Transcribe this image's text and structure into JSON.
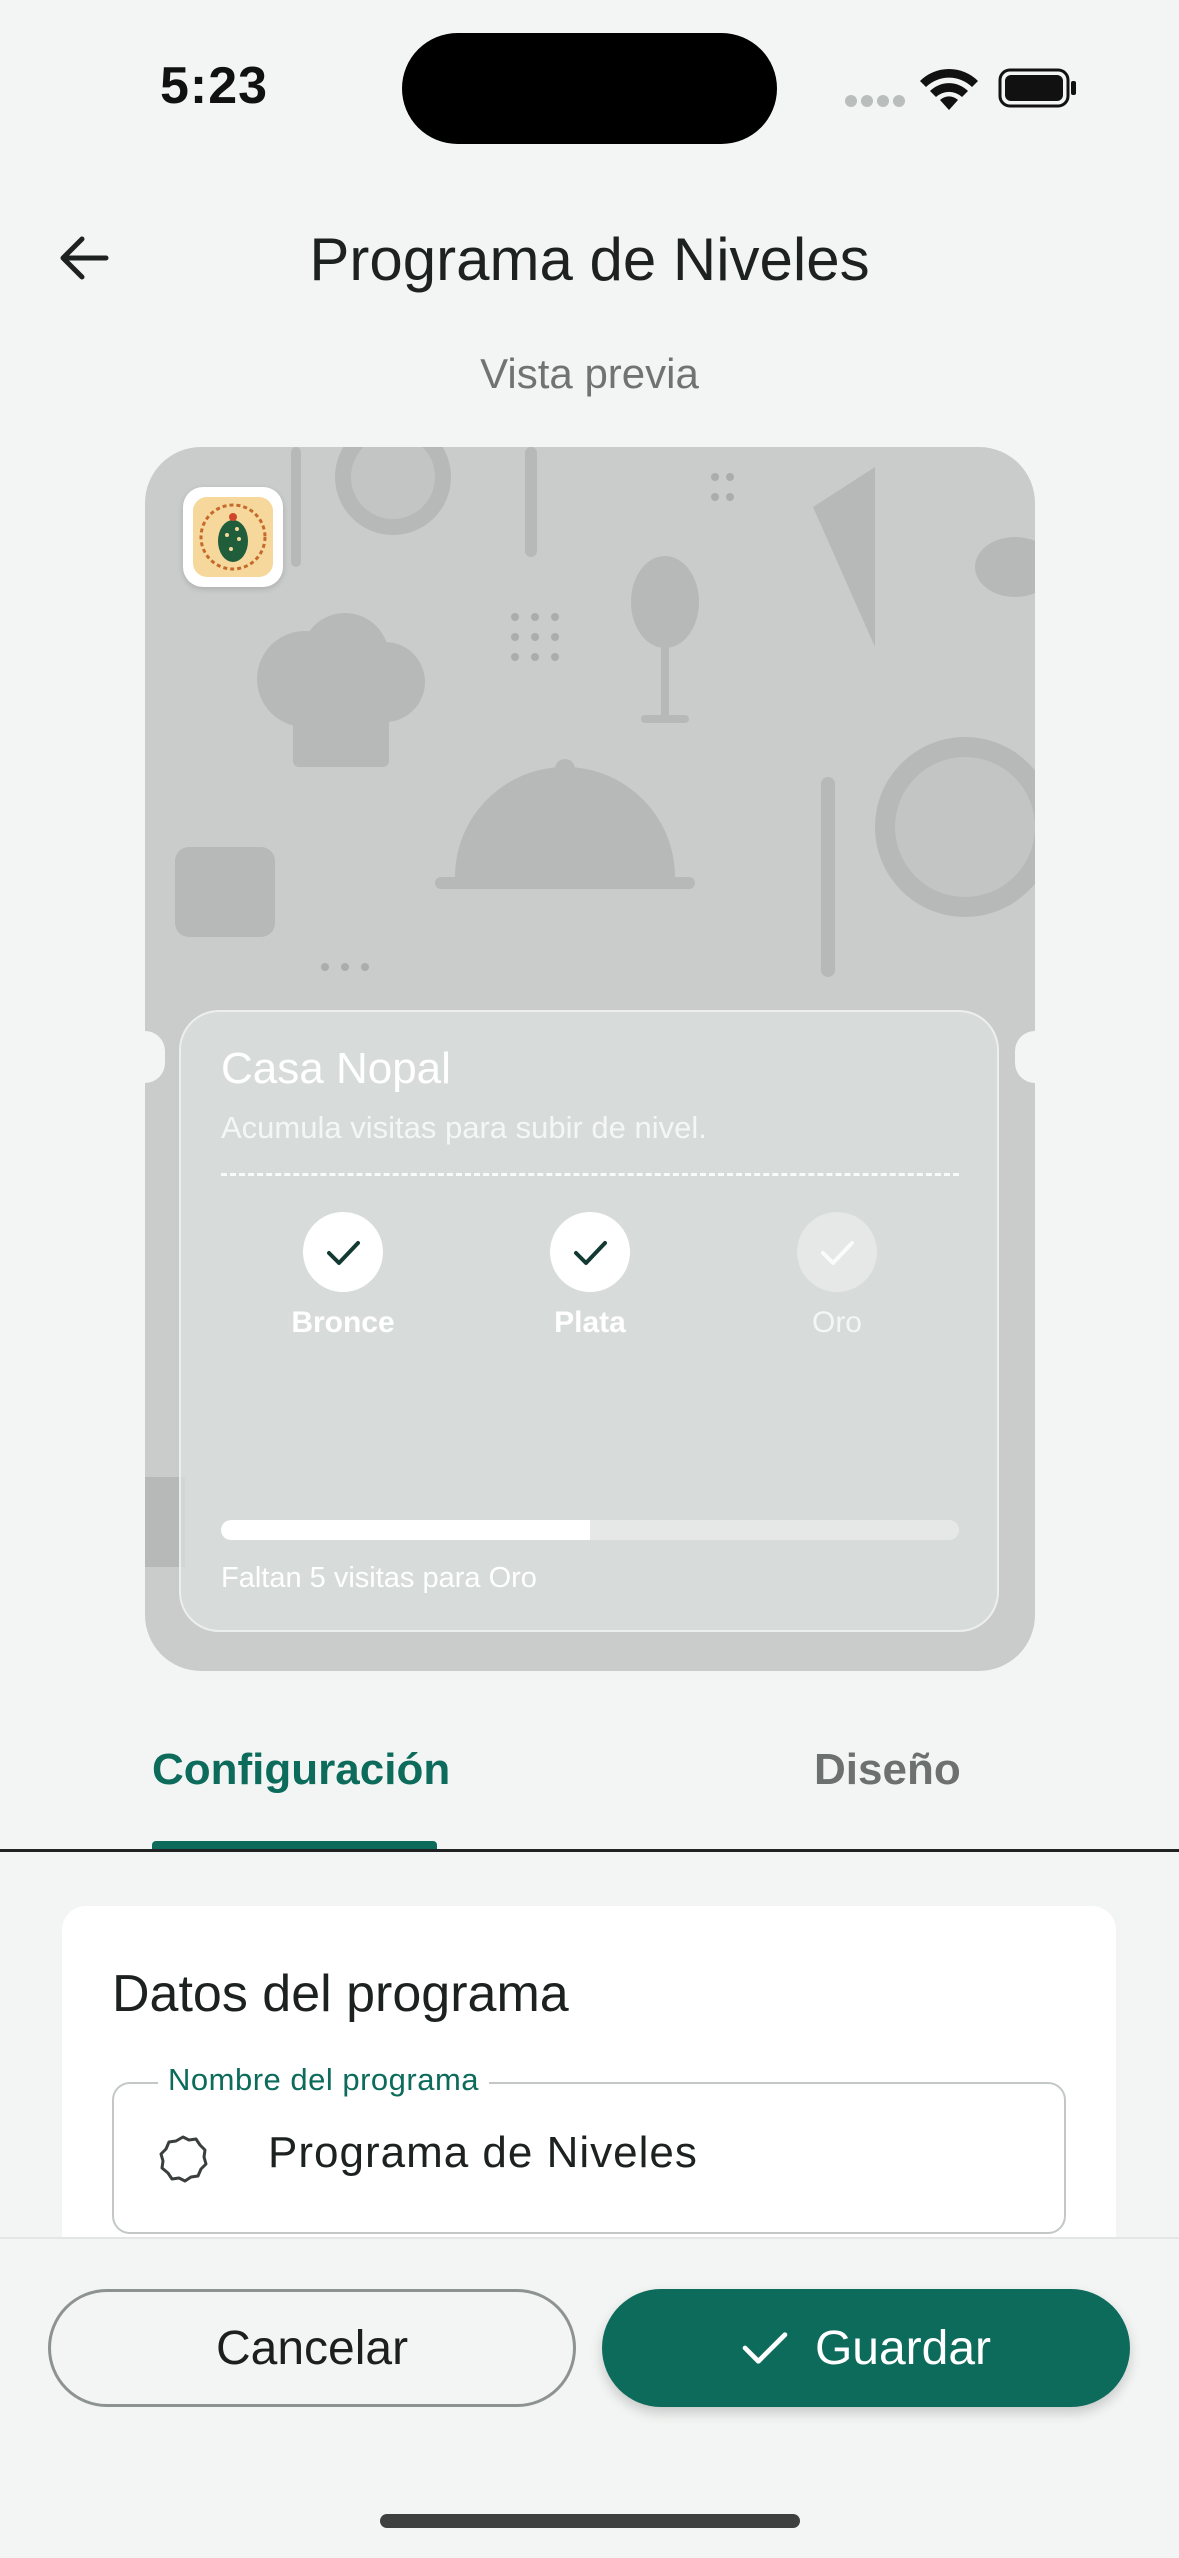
{
  "status_bar": {
    "time": "5:23"
  },
  "header": {
    "title": "Programa de Niveles",
    "preview_label": "Vista previa"
  },
  "card": {
    "business_name": "Casa Nopal",
    "subtitle": "Acumula visitas para subir de nivel.",
    "tiers": [
      {
        "name": "Bronce",
        "achieved": true
      },
      {
        "name": "Plata",
        "achieved": true
      },
      {
        "name": "Oro",
        "achieved": false
      }
    ],
    "progress": 0.5,
    "progress_text": "Faltan 5 visitas para Oro"
  },
  "tabs": [
    {
      "label": "Configuración",
      "active": true
    },
    {
      "label": "Diseño",
      "active": false
    }
  ],
  "form": {
    "section_title": "Datos del programa",
    "program_name_label": "Nombre del programa",
    "program_name_value": "Programa de Niveles"
  },
  "actions": {
    "cancel": "Cancelar",
    "save": "Guardar"
  },
  "colors": {
    "primary": "#0c6b5b",
    "background": "#f3f5f4"
  },
  "icons": {
    "back": "arrow-left-icon",
    "check": "check-icon",
    "field": "circle-outline-icon",
    "logo": "cactus-logo-icon"
  }
}
